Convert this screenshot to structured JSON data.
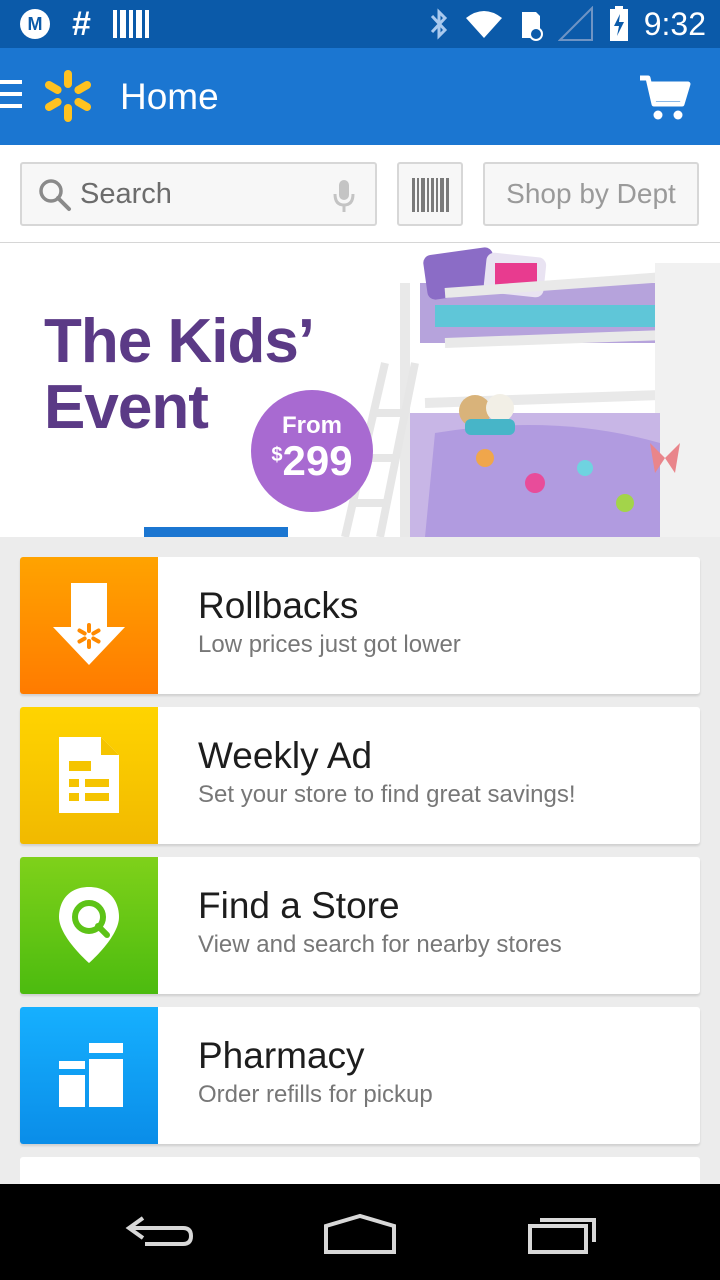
{
  "status_bar": {
    "time": "9:32",
    "left_icons": [
      "motorola-icon",
      "hashtag-icon",
      "barcode-notification-icon"
    ],
    "right_icons": [
      "bluetooth-icon",
      "wifi-icon",
      "sd-card-icon",
      "signal-icon",
      "battery-charging-icon"
    ]
  },
  "app_bar": {
    "title": "Home",
    "colors": {
      "primary": "#1b76d1",
      "status": "#0b5aa9",
      "spark": "#ffc220"
    }
  },
  "search": {
    "placeholder": "Search",
    "dept_label": "Shop by Dept"
  },
  "banner": {
    "title_line1": "The Kids’",
    "title_line2": "Event",
    "badge_from": "From",
    "badge_currency": "$",
    "badge_price": "299"
  },
  "cards": [
    {
      "title": "Rollbacks",
      "subtitle": "Low prices just got lower",
      "icon": "rollback-arrow-icon",
      "color": "#ff8a00"
    },
    {
      "title": "Weekly Ad",
      "subtitle": "Set your store to find great savings!",
      "icon": "weekly-ad-icon",
      "color": "#f5c400"
    },
    {
      "title": "Find a Store",
      "subtitle": "View and search for nearby stores",
      "icon": "store-locator-icon",
      "color": "#5dc317"
    },
    {
      "title": "Pharmacy",
      "subtitle": "Order refills for pickup",
      "icon": "pharmacy-icon",
      "color": "#0d99f2"
    }
  ],
  "nav_bar": {
    "icons": [
      "back-icon",
      "home-icon",
      "recent-apps-icon"
    ]
  }
}
